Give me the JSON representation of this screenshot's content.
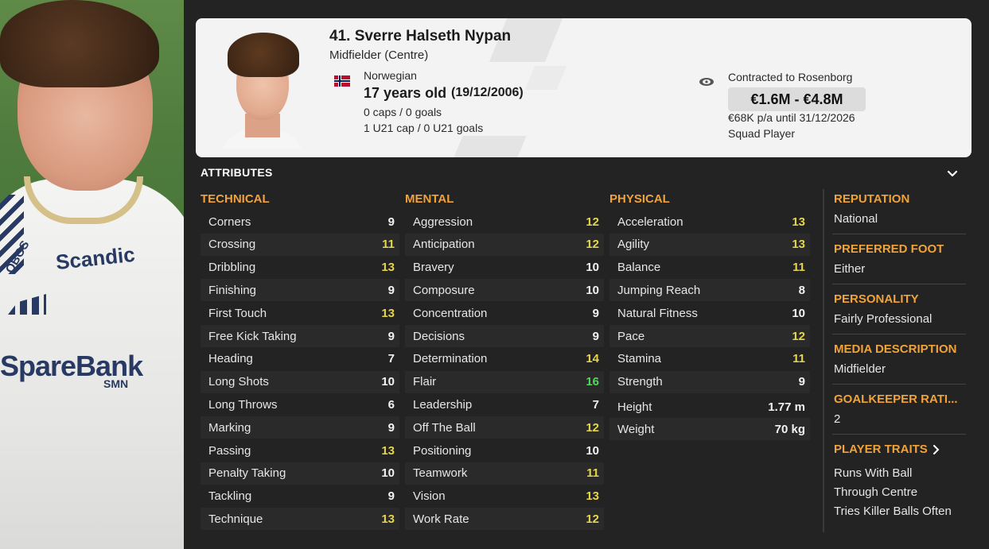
{
  "player": {
    "name": "41. Sverre Halseth Nypan",
    "position": "Midfielder (Centre)",
    "nationality": "Norwegian",
    "age": "17 years old",
    "dob": "(19/12/2006)",
    "caps": "0 caps / 0 goals",
    "u21_caps": "1 U21 cap / 0 U21 goals"
  },
  "contract": {
    "contracted_to": "Contracted to Rosenborg",
    "value_range": "€1.6M - €4.8M",
    "wage": "€68K p/a until 31/12/2026",
    "squad_status": "Squad Player"
  },
  "attributes_title": "ATTRIBUTES",
  "technical": {
    "header": "TECHNICAL",
    "items": [
      {
        "label": "Corners",
        "value": "9"
      },
      {
        "label": "Crossing",
        "value": "11"
      },
      {
        "label": "Dribbling",
        "value": "13"
      },
      {
        "label": "Finishing",
        "value": "9"
      },
      {
        "label": "First Touch",
        "value": "13"
      },
      {
        "label": "Free Kick Taking",
        "value": "9"
      },
      {
        "label": "Heading",
        "value": "7"
      },
      {
        "label": "Long Shots",
        "value": "10"
      },
      {
        "label": "Long Throws",
        "value": "6"
      },
      {
        "label": "Marking",
        "value": "9"
      },
      {
        "label": "Passing",
        "value": "13"
      },
      {
        "label": "Penalty Taking",
        "value": "10"
      },
      {
        "label": "Tackling",
        "value": "9"
      },
      {
        "label": "Technique",
        "value": "13"
      }
    ]
  },
  "mental": {
    "header": "MENTAL",
    "items": [
      {
        "label": "Aggression",
        "value": "12"
      },
      {
        "label": "Anticipation",
        "value": "12"
      },
      {
        "label": "Bravery",
        "value": "10"
      },
      {
        "label": "Composure",
        "value": "10"
      },
      {
        "label": "Concentration",
        "value": "9"
      },
      {
        "label": "Decisions",
        "value": "9"
      },
      {
        "label": "Determination",
        "value": "14"
      },
      {
        "label": "Flair",
        "value": "16"
      },
      {
        "label": "Leadership",
        "value": "7"
      },
      {
        "label": "Off The Ball",
        "value": "12"
      },
      {
        "label": "Positioning",
        "value": "10"
      },
      {
        "label": "Teamwork",
        "value": "11"
      },
      {
        "label": "Vision",
        "value": "13"
      },
      {
        "label": "Work Rate",
        "value": "12"
      }
    ]
  },
  "physical": {
    "header": "PHYSICAL",
    "items": [
      {
        "label": "Acceleration",
        "value": "13"
      },
      {
        "label": "Agility",
        "value": "13"
      },
      {
        "label": "Balance",
        "value": "11"
      },
      {
        "label": "Jumping Reach",
        "value": "8"
      },
      {
        "label": "Natural Fitness",
        "value": "10"
      },
      {
        "label": "Pace",
        "value": "12"
      },
      {
        "label": "Stamina",
        "value": "11"
      },
      {
        "label": "Strength",
        "value": "9"
      }
    ],
    "height_label": "Height",
    "height_value": "1.77 m",
    "weight_label": "Weight",
    "weight_value": "70 kg"
  },
  "sidebar": {
    "reputation_header": "REPUTATION",
    "reputation_value": "National",
    "foot_header": "PREFERRED FOOT",
    "foot_value": "Either",
    "personality_header": "PERSONALITY",
    "personality_value": "Fairly Professional",
    "media_header": "MEDIA DESCRIPTION",
    "media_value": "Midfielder",
    "gk_header": "GOALKEEPER RATI...",
    "gk_value": "2",
    "traits_header": "PLAYER TRAITS",
    "traits": [
      "Runs With Ball",
      "Through Centre",
      "Tries Killer Balls Often"
    ]
  },
  "colors": {
    "accent_orange": "#f0a23b",
    "value_white": "#f2f2f2",
    "value_yellow": "#e6d54a",
    "value_green": "#54d75a",
    "background": "#232323",
    "card": "#f3f3f3"
  }
}
